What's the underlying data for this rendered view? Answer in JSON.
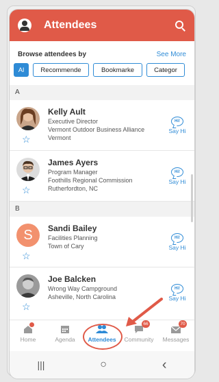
{
  "header": {
    "title": "Attendees"
  },
  "browse": {
    "label": "Browse attendees by",
    "see_more": "See More",
    "chips": [
      "Al",
      "Recommende",
      "Bookmarke",
      "Categor"
    ]
  },
  "sections": [
    "A",
    "B"
  ],
  "attendees": [
    {
      "name": "Kelly Ault",
      "lines": [
        "Executive Director",
        "Vermont Outdoor Business Alliance",
        "Vermont"
      ],
      "say_hi": "Say Hi",
      "bubble": "Hi!"
    },
    {
      "name": "James Ayers",
      "lines": [
        "Program Manager",
        "Foothills Regional Commission",
        "Rutherfordton, NC"
      ],
      "say_hi": "Say Hi",
      "bubble": "Hi!"
    },
    {
      "name": "Sandi Bailey",
      "initial": "S",
      "lines": [
        "Facilities Planning",
        "Town of Cary"
      ],
      "say_hi": "Say Hi",
      "bubble": "Hi!"
    },
    {
      "name": "Joe Balcken",
      "lines": [
        "Wrong Way Campground",
        "Asheville, North Carolina"
      ],
      "say_hi": "Say Hi",
      "bubble": "Hi!"
    }
  ],
  "tabs": [
    {
      "label": "Home",
      "icon": "home-icon"
    },
    {
      "label": "Agenda",
      "icon": "calendar-icon"
    },
    {
      "label": "Attendees",
      "icon": "people-icon"
    },
    {
      "label": "Community",
      "icon": "chat-icon",
      "badge": "66"
    },
    {
      "label": "Messages",
      "icon": "mail-icon",
      "badge": "70"
    }
  ],
  "navbar": {
    "recent": "|||",
    "home": "○",
    "back": "‹"
  },
  "colors": {
    "brand": "#e05a48",
    "accent": "#2e8bd6"
  }
}
